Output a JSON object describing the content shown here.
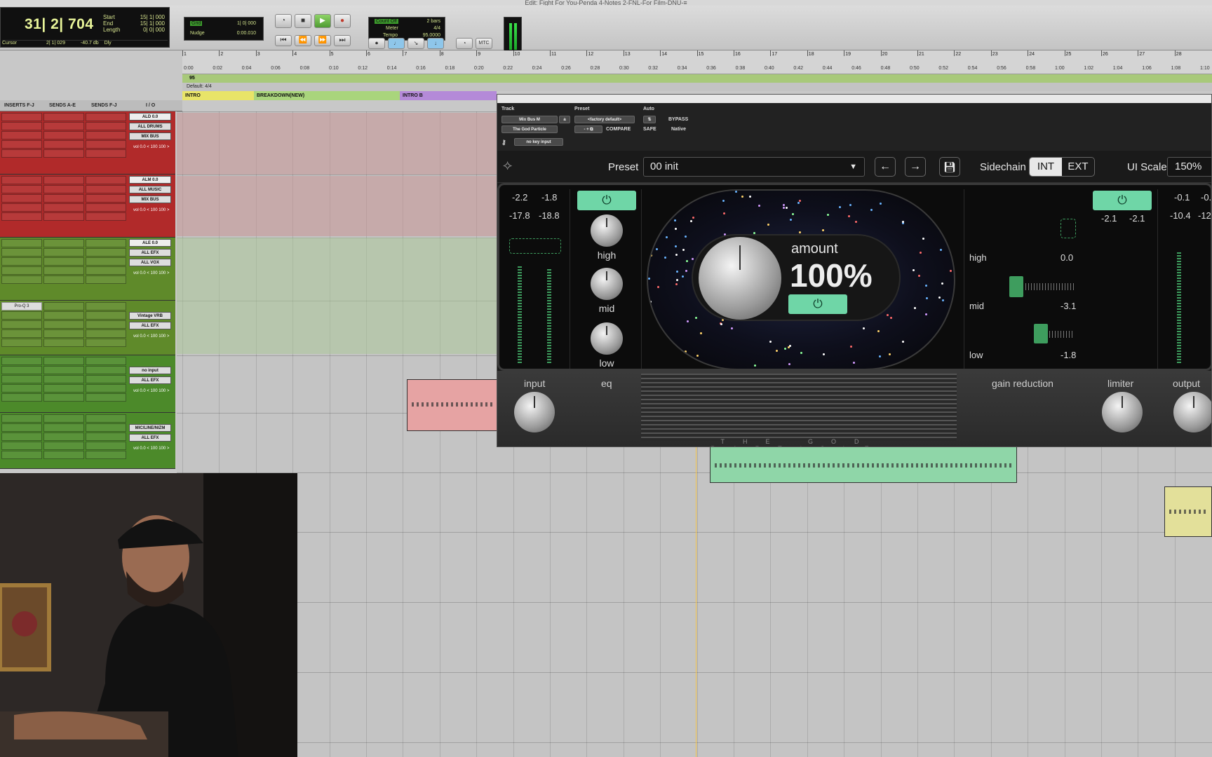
{
  "window_title": "Edit: Fight For You-Penda 4-Notes 2-FNL-For Film-DNU-≡",
  "transport": {
    "main_counter": "31| 2| 704",
    "start_label": "Start",
    "end_label": "End",
    "length_label": "Length",
    "start_val": "15| 1| 000",
    "end_val": "15| 1| 000",
    "length_val": "0| 0| 000",
    "cursor_label": "Cursor",
    "cursor_val": "2| 1| 029",
    "cursor_db": "-40.7 db",
    "dly_label": "Dly",
    "grid_label": "Grid",
    "grid_val": "1| 0| 000",
    "nudge_label": "Nudge",
    "nudge_val": "0:00.010",
    "countoff_label": "Count Off",
    "meter_label": "Meter",
    "tempo_label": "Tempo",
    "countoff_val": "2 bars",
    "meter_val": "4/4",
    "tempo_val": "95.0000",
    "mtc_label": "MTC"
  },
  "ruler": {
    "bars": [
      "1",
      "2",
      "3",
      "4",
      "5",
      "6",
      "7",
      "8",
      "9",
      "10",
      "11",
      "12",
      "13",
      "14",
      "15",
      "16",
      "17",
      "18",
      "19",
      "20",
      "21",
      "22",
      "23",
      "24",
      "25",
      "26",
      "27",
      "28"
    ],
    "times": [
      "0:00",
      "0:02",
      "0:04",
      "0:06",
      "0:08",
      "0:10",
      "0:12",
      "0:14",
      "0:16",
      "0:18",
      "0:20",
      "0:22",
      "0:24",
      "0:26",
      "0:28",
      "0:30",
      "0:32",
      "0:34",
      "0:36",
      "0:38",
      "0:40",
      "0:42",
      "0:44",
      "0:46",
      "0:48",
      "0:50",
      "0:52",
      "0:54",
      "0:56",
      "0:58",
      "1:00",
      "1:02",
      "1:04",
      "1:06",
      "1:08",
      "1:10"
    ]
  },
  "markers": {
    "tempo_marker": "95",
    "meter_marker": "Default: 4/4",
    "items": [
      "INTRO",
      "BREAKDOWN(NEW)",
      "INTRO B"
    ]
  },
  "columns": {
    "inserts": "INSERTS F-J",
    "sends_ae": "SENDS A-E",
    "sends_fj": "SENDS F-J",
    "io": "I / O"
  },
  "tracks": [
    {
      "name": "ALD",
      "vol": "0.0",
      "io1": "ALL DRUMS",
      "io2": "MIX BUS",
      "vol_val": "0.0",
      "pan": "< 100",
      "pan2": "100 >"
    },
    {
      "name": "ALM",
      "vol": "0.0",
      "io1": "ALL MUSIC",
      "io2": "MIX BUS",
      "vol_val": "0.0",
      "pan": "< 100",
      "pan2": "100 >"
    },
    {
      "name": "ALE",
      "vol": "0.0",
      "io1": "ALL EFX",
      "io2": "ALL VOX",
      "vol_val": "0.0",
      "pan": "< 100",
      "pan2": "100 >"
    },
    {
      "name": "",
      "vol": "",
      "io1": "Vintage VRB",
      "io2": "ALL EFX",
      "vol_val": "0.0",
      "pan": "< 100",
      "pan2": "100 >",
      "insert": "Pro-Q 3"
    },
    {
      "name": "",
      "vol": "",
      "io1": "no input",
      "io2": "ALL EFX",
      "vol_val": "0.0",
      "pan": "< 100",
      "pan2": "100 >"
    },
    {
      "name": "",
      "vol": "",
      "io1": "MIC/LINE/NIZM",
      "io2": "ALL EFX",
      "vol_val": "0.0",
      "pan": "< 100",
      "pan2": "100 >"
    }
  ],
  "vol_label": "vol",
  "plugin": {
    "header": {
      "track_label": "Track",
      "preset_label": "Preset",
      "auto_label": "Auto",
      "track_name": "Mix Bus M",
      "insert_name": "The God Particle",
      "factory_default": "<factory default>",
      "compare": "COMPARE",
      "safe": "SAFE",
      "bypass": "BYPASS",
      "native": "Native",
      "key_input": "no key input"
    },
    "preset_label": "Preset",
    "preset_value": "00 init",
    "sidechain_label": "Sidechain",
    "sc_int": "INT",
    "sc_ext": "EXT",
    "ui_scale_label": "UI Scale",
    "ui_scale_value": "150%",
    "input_meters": {
      "peak_l": "-2.2",
      "peak_r": "-1.8",
      "rms_l": "-17.8",
      "rms_r": "-18.8"
    },
    "eq": {
      "high": "high",
      "mid": "mid",
      "low": "low"
    },
    "amount_label": "amount",
    "amount_value": "100%",
    "gr": {
      "high_label": "high",
      "high_val": "0.0",
      "mid_label": "mid",
      "mid_val": "-3.1",
      "low_label": "low",
      "low_val": "-1.8"
    },
    "limiter_meters": {
      "l": "-2.1",
      "r": "-2.1"
    },
    "output_meters": {
      "peak_l": "-0.1",
      "peak_r": "-0.",
      "rms_l": "-10.4",
      "rms_r": "-12"
    },
    "bottom": {
      "input": "input",
      "eq": "eq",
      "gain_reduction": "gain reduction",
      "limiter": "limiter",
      "output": "output"
    },
    "brand": "THE GOD PARTICLE"
  }
}
